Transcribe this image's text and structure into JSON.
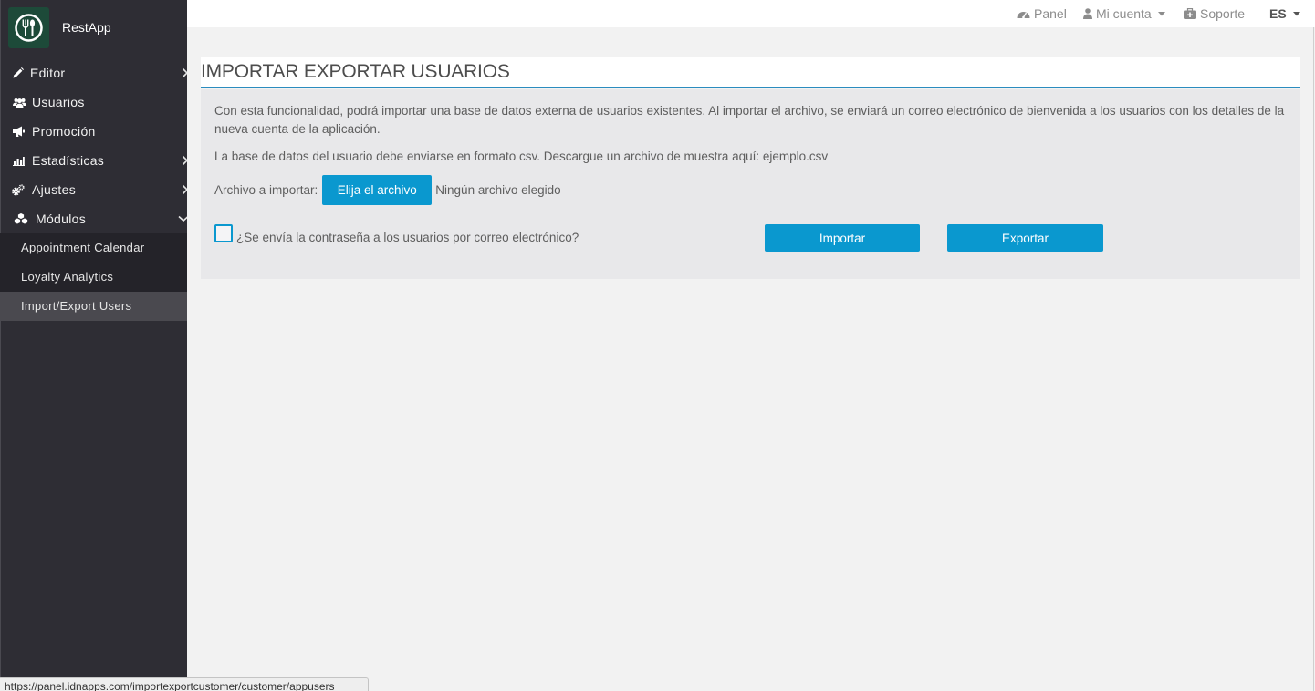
{
  "theme": {
    "accent": "#0a98cf",
    "sidebar": "#2e2d34",
    "logo": "#1d4a39",
    "underline": "#2a8cbf"
  },
  "app": {
    "name": "RestApp",
    "logo_icon": "restaurant-icon"
  },
  "sidebar": {
    "items": [
      {
        "label": "Editor",
        "icon": "pencil-icon",
        "chevron_icon": "chevron-right-icon"
      },
      {
        "label": "Usuarios",
        "icon": "users-icon"
      },
      {
        "label": "Promoción",
        "icon": "bullhorn-icon"
      },
      {
        "label": "Estadísticas",
        "icon": "bar-chart-icon",
        "chevron_icon": "chevron-right-icon"
      },
      {
        "label": "Ajustes",
        "icon": "cogs-icon",
        "chevron_icon": "chevron-right-icon"
      },
      {
        "label": "Módulos",
        "icon": "cubes-icon",
        "chevron_icon": "chevron-down-icon",
        "expanded": true
      }
    ],
    "submenu": [
      {
        "label": "Appointment Calendar",
        "active": false
      },
      {
        "label": "Loyalty Analytics",
        "active": false
      },
      {
        "label": "Import/Export Users",
        "active": true
      }
    ]
  },
  "topbar": {
    "panel": {
      "label": "Panel",
      "icon": "dashboard-icon"
    },
    "account": {
      "label": "Mi cuenta",
      "icon": "user-icon"
    },
    "support": {
      "label": "Soporte",
      "icon": "medkit-icon"
    },
    "language": {
      "label": "ES"
    }
  },
  "page": {
    "title": "IMPORTAR EXPORTAR USUARIOS",
    "description": "Con esta funcionalidad, podrá importar una base de datos externa de usuarios existentes. Al importar el archivo, se enviará un correo electrónico de bienvenida a los usuarios con los detalles de la nueva cuenta de la aplicación.",
    "format_note": "La base de datos del usuario debe enviarse en formato csv. Descargue un archivo de muestra aquí:",
    "sample_link": "ejemplo.csv",
    "file_label": "Archivo a importar:",
    "file_button": "Elija el archivo",
    "file_status": "Ningún archivo elegido",
    "send_password_label": "¿Se envía la contraseña a los usuarios por correo electrónico?",
    "send_password_checked": false,
    "import_button": "Importar",
    "export_button": "Exportar"
  },
  "status_bar": {
    "url": "https://panel.idnapps.com/importexportcustomer/customer/appusers"
  }
}
